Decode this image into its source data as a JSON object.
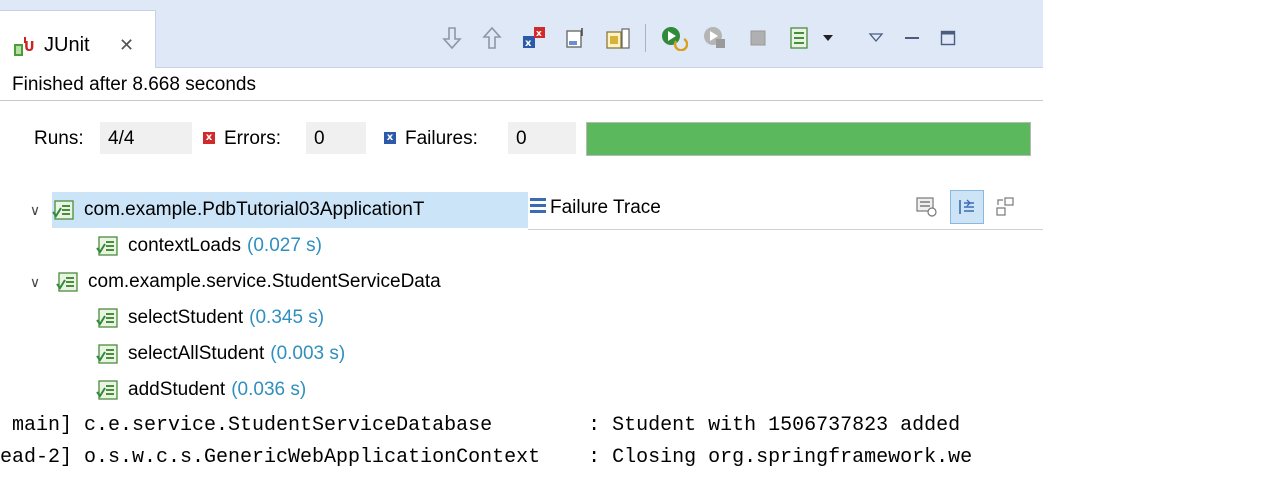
{
  "tab": {
    "title": "JUnit",
    "close_glyph": "✕"
  },
  "toolbar": {
    "buttons": [
      {
        "name": "next-failure-icon"
      },
      {
        "name": "previous-failure-icon"
      },
      {
        "name": "show-failures-only-icon"
      },
      {
        "name": "scroll-lock-icon"
      },
      {
        "name": "show-skipped-icon"
      },
      {
        "name": "rerun-test-icon"
      },
      {
        "name": "rerun-failed-first-icon"
      },
      {
        "name": "stop-icon"
      },
      {
        "name": "test-run-history-icon"
      },
      {
        "name": "history-dropdown-icon"
      },
      {
        "name": "view-menu-icon"
      },
      {
        "name": "minimize-icon"
      },
      {
        "name": "maximize-icon"
      }
    ]
  },
  "status": {
    "message": "Finished after 8.668 seconds"
  },
  "counters": {
    "runs_label": "Runs:",
    "runs_value": "4/4",
    "errors_label": "Errors:",
    "errors_value": "0",
    "failures_label": "Failures:",
    "failures_value": "0",
    "progress_fraction": 1.0,
    "progress_color": "#5cb85c"
  },
  "tree": [
    {
      "label": "com.example.PdbTutorial03ApplicationT",
      "time": "",
      "level": 0,
      "expanded": true,
      "selected": true,
      "kind": "suite"
    },
    {
      "label": "contextLoads",
      "time": "(0.027 s)",
      "level": 1,
      "kind": "test"
    },
    {
      "label": "com.example.service.StudentServiceData",
      "time": "",
      "level": 0,
      "expanded": true,
      "selected": false,
      "kind": "suite"
    },
    {
      "label": "selectStudent",
      "time": "(0.345 s)",
      "level": 1,
      "kind": "test"
    },
    {
      "label": "selectAllStudent",
      "time": "(0.003 s)",
      "level": 1,
      "kind": "test"
    },
    {
      "label": "addStudent",
      "time": "(0.036 s)",
      "level": 1,
      "kind": "test"
    }
  ],
  "trace": {
    "title": "Failure Trace"
  },
  "console": {
    "lines": [
      " main] c.e.service.StudentServiceDatabase        : Student with 1506737823 added",
      "ead-2] o.s.w.c.s.GenericWebApplicationContext    : Closing org.springframework.we"
    ]
  },
  "colors": {
    "time_color": "#2f8fbf",
    "selection": "#cce4f7",
    "tabbar": "#dfe8f6"
  }
}
